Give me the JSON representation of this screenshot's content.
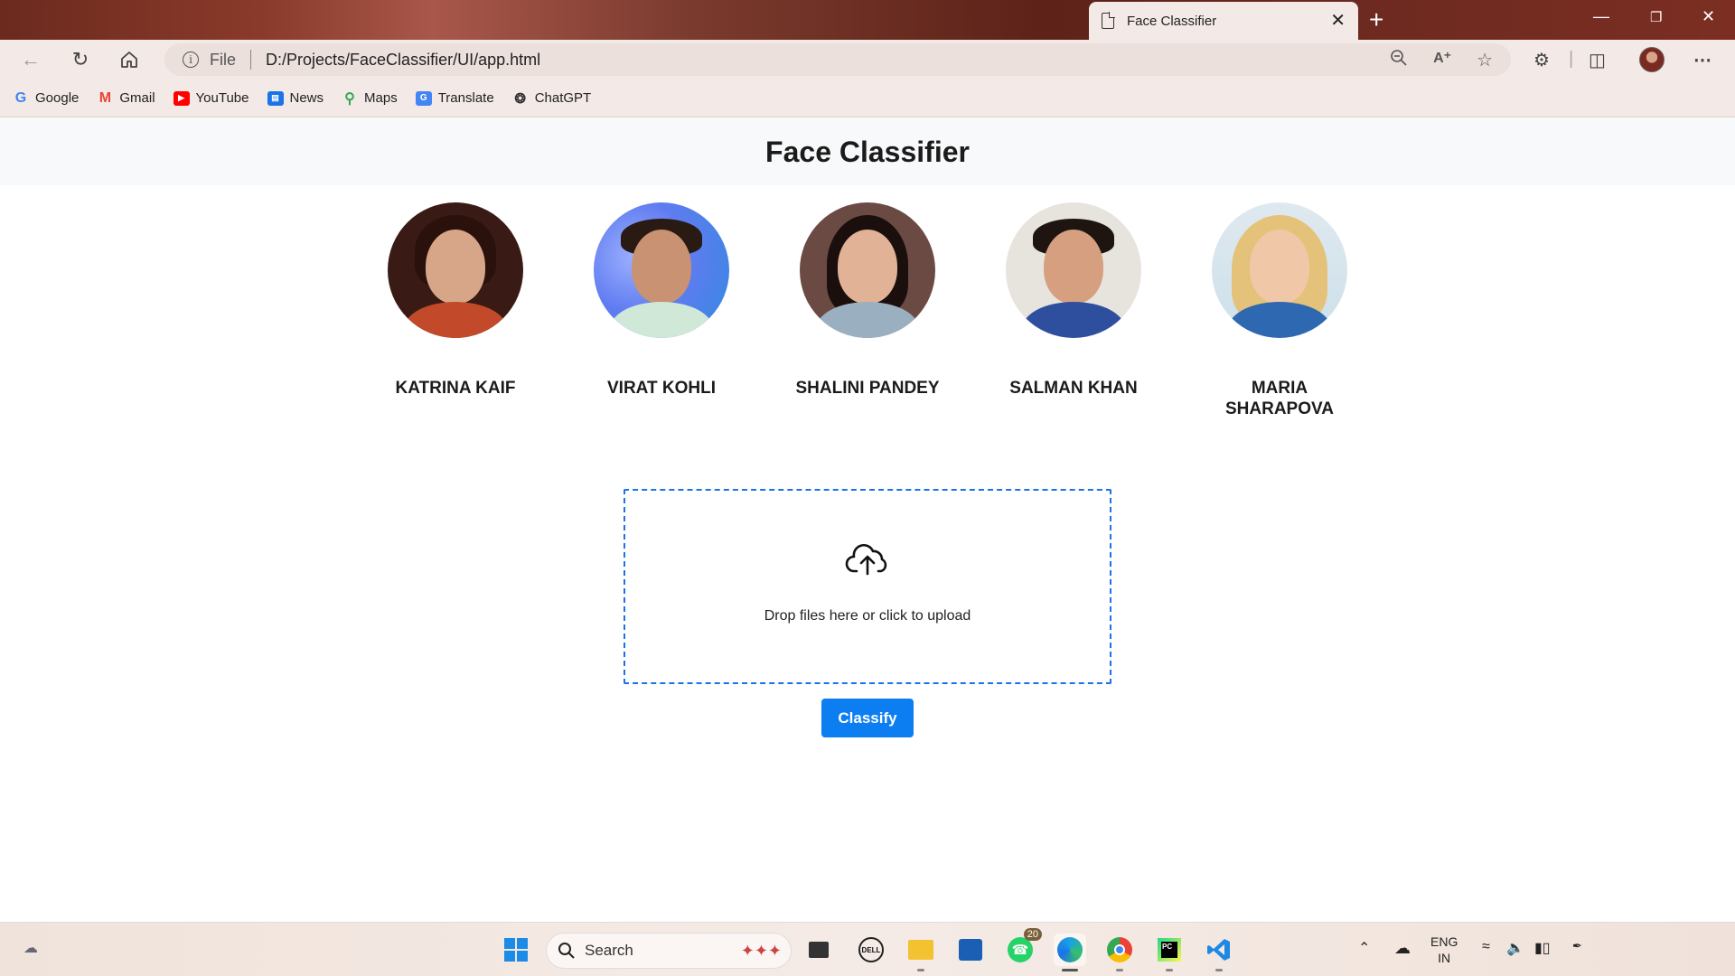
{
  "browser": {
    "tab_title": "Face Classifier",
    "tab_close": "✕",
    "new_tab": "+",
    "file_label": "File",
    "url": "D:/Projects/FaceClassifier/UI/app.html",
    "bookmarks": [
      {
        "label": "Google",
        "icon": "google-icon",
        "color": "#4285f4"
      },
      {
        "label": "Gmail",
        "icon": "gmail-icon",
        "color": "#ea4335"
      },
      {
        "label": "YouTube",
        "icon": "youtube-icon",
        "color": "#ff0000"
      },
      {
        "label": "News",
        "icon": "news-icon",
        "color": "#1a73e8"
      },
      {
        "label": "Maps",
        "icon": "maps-icon",
        "color": "#34a853"
      },
      {
        "label": "Translate",
        "icon": "translate-icon",
        "color": "#4285f4"
      },
      {
        "label": "ChatGPT",
        "icon": "chatgpt-icon",
        "color": "#333333"
      }
    ]
  },
  "page": {
    "title": "Face Classifier",
    "people": [
      {
        "name": "KATRINA KAIF"
      },
      {
        "name": "VIRAT KOHLI"
      },
      {
        "name": "SHALINI PANDEY"
      },
      {
        "name": "SALMAN KHAN"
      },
      {
        "name": "MARIA SHARAPOVA"
      }
    ],
    "dropzone_text": "Drop files here or click to upload",
    "classify_label": "Classify",
    "accent": "#0d7ef2"
  },
  "taskbar": {
    "search_label": "Search",
    "whatsapp_badge": "20",
    "lang_line1": "ENG",
    "lang_line2": "IN"
  }
}
